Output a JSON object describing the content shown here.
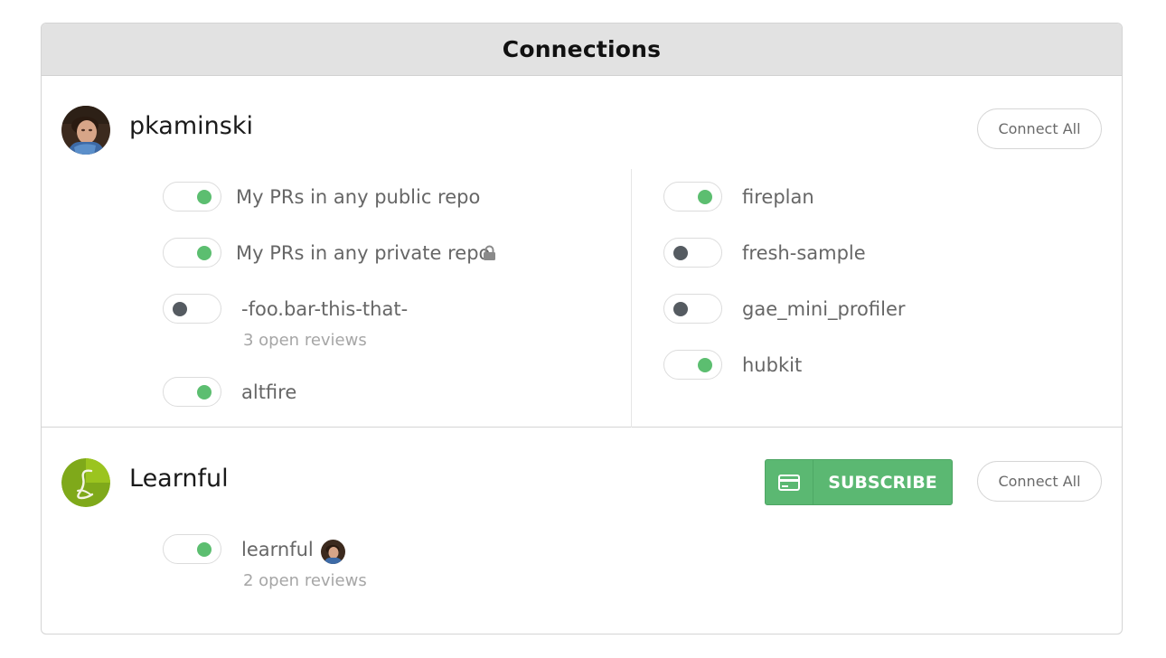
{
  "panel": {
    "title": "Connections"
  },
  "orgs": [
    {
      "name": "pkaminski",
      "connect_all_label": "Connect All",
      "repos_left": [
        {
          "label": "My PRs in any public repo",
          "enabled": true
        },
        {
          "label": "My PRs in any private repo",
          "enabled": true,
          "icon": "lock-icon"
        },
        {
          "label": "-foo.bar-this-that-",
          "enabled": false,
          "sublabel": "3 open reviews"
        },
        {
          "label": "altfire",
          "enabled": true
        }
      ],
      "repos_right": [
        {
          "label": "fireplan",
          "enabled": true
        },
        {
          "label": "fresh-sample",
          "enabled": false
        },
        {
          "label": "gae_mini_profiler",
          "enabled": false
        },
        {
          "label": "hubkit",
          "enabled": true
        }
      ]
    },
    {
      "name": "Learnful",
      "subscribe_label": "SUBSCRIBE",
      "subscribe_icon": "credit-card-icon",
      "connect_all_label": "Connect All",
      "repos": [
        {
          "label": "learnful",
          "enabled": true,
          "sublabel": "2 open reviews",
          "icon": "user-avatar"
        }
      ]
    }
  ],
  "colors": {
    "toggle_on": "#5cbe70",
    "toggle_off": "#555b61",
    "subscribe_bg": "#5bb872",
    "header_bg": "#e2e2e2"
  }
}
